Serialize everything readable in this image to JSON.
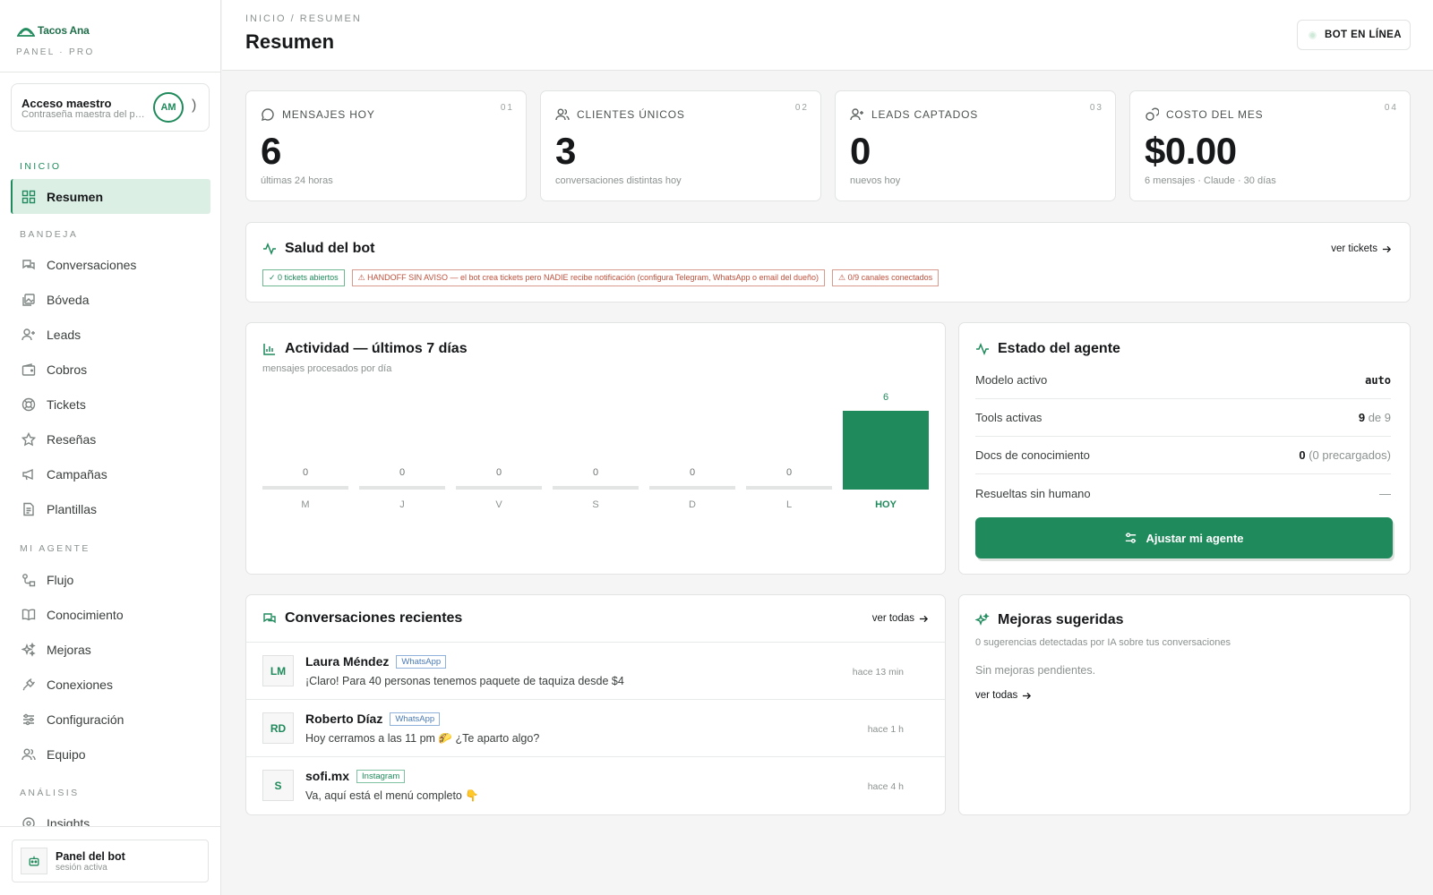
{
  "brand": {
    "name": "Tacos Ana",
    "subtitle": "PANEL · PRO"
  },
  "master_access": {
    "title": "Acceso maestro",
    "subtitle": "Contraseña maestra del panel",
    "initials": "AM",
    "trailing": ")"
  },
  "nav": {
    "sections": [
      "INICIO",
      "BANDEJA",
      "MI AGENTE",
      "ANÁLISIS"
    ],
    "items": [
      {
        "label": "Resumen",
        "icon": "grid-icon"
      },
      {
        "label": "Conversaciones",
        "icon": "chat-icon"
      },
      {
        "label": "Bóveda",
        "icon": "images-icon"
      },
      {
        "label": "Leads",
        "icon": "user-plus-icon"
      },
      {
        "label": "Cobros",
        "icon": "wallet-icon"
      },
      {
        "label": "Tickets",
        "icon": "lifebuoy-icon"
      },
      {
        "label": "Reseñas",
        "icon": "star-icon"
      },
      {
        "label": "Campañas",
        "icon": "megaphone-icon"
      },
      {
        "label": "Plantillas",
        "icon": "file-icon"
      },
      {
        "label": "Flujo",
        "icon": "flow-icon"
      },
      {
        "label": "Conocimiento",
        "icon": "book-icon"
      },
      {
        "label": "Mejoras",
        "icon": "sparkles-icon"
      },
      {
        "label": "Conexiones",
        "icon": "plug-icon"
      },
      {
        "label": "Configuración",
        "icon": "sliders-icon"
      },
      {
        "label": "Equipo",
        "icon": "users-icon"
      },
      {
        "label": "Insights",
        "icon": "radar-icon"
      }
    ]
  },
  "footer": {
    "title": "Panel del bot",
    "subtitle": "sesión activa"
  },
  "header": {
    "breadcrumb": "INICIO / RESUMEN",
    "title": "Resumen",
    "status": "BOT EN LÍNEA"
  },
  "stats": [
    {
      "label": "MENSAJES HOY",
      "num": "01",
      "value": "6",
      "sub": "últimas 24 horas",
      "icon": "message-circle-icon"
    },
    {
      "label": "CLIENTES ÚNICOS",
      "num": "02",
      "value": "3",
      "sub": "conversaciones distintas hoy",
      "icon": "users-icon"
    },
    {
      "label": "LEADS CAPTADOS",
      "num": "03",
      "value": "0",
      "sub": "nuevos hoy",
      "icon": "user-plus-icon"
    },
    {
      "label": "COSTO DEL MES",
      "num": "04",
      "value": "$0.00",
      "sub": "6 mensajes · Claude · 30 días",
      "icon": "coins-icon"
    }
  ],
  "health": {
    "title": "Salud del bot",
    "link": "ver tickets",
    "pills": [
      {
        "text": "✓ 0 tickets abiertos",
        "kind": "ok"
      },
      {
        "text": "⚠ HANDOFF SIN AVISO — el bot crea tickets pero NADIE recibe notificación (configura Telegram, WhatsApp o email del dueño)",
        "kind": "warn"
      },
      {
        "text": "⚠ 0/9 canales conectados",
        "kind": "warn"
      }
    ]
  },
  "activity": {
    "title": "Actividad — últimos 7 días",
    "subtitle": "mensajes procesados por día"
  },
  "chart_data": {
    "type": "bar",
    "categories": [
      "M",
      "J",
      "V",
      "S",
      "D",
      "L",
      "HOY"
    ],
    "values": [
      0,
      0,
      0,
      0,
      0,
      0,
      6
    ],
    "ylim": [
      0,
      6
    ],
    "highlight": "HOY",
    "grid": false,
    "colors": {
      "bar": "#1f8a5b",
      "empty": "#e2e5e3"
    }
  },
  "agent": {
    "title": "Estado del agente",
    "rows": [
      {
        "label": "Modelo activo",
        "value": "auto",
        "suffix": ""
      },
      {
        "label": "Tools activas",
        "value": "9",
        "suffix": " de 9"
      },
      {
        "label": "Docs de conocimiento",
        "value": "0",
        "suffix": " (0 precargados)"
      },
      {
        "label": "Resueltas sin humano",
        "value": "",
        "suffix": "—"
      }
    ],
    "button": "Ajustar mi agente"
  },
  "recent": {
    "title": "Conversaciones recientes",
    "link": "ver todas",
    "items": [
      {
        "initials": "LM",
        "name": "Laura Méndez",
        "channel": "WhatsApp",
        "message": "¡Claro! Para 40 personas tenemos paquete de taquiza desde $4",
        "time": "hace 13 min"
      },
      {
        "initials": "RD",
        "name": "Roberto Díaz",
        "channel": "WhatsApp",
        "message": "Hoy cerramos a las 11 pm 🌮 ¿Te aparto algo?",
        "time": "hace 1 h"
      },
      {
        "initials": "S",
        "name": "sofi.mx",
        "channel": "Instagram",
        "message": "Va, aquí está el menú completo 👇",
        "time": "hace 4 h"
      }
    ]
  },
  "suggestions": {
    "title": "Mejoras sugeridas",
    "subtitle": "0 sugerencias detectadas por IA sobre tus conversaciones",
    "empty": "Sin mejoras pendientes.",
    "link": "ver todas"
  },
  "colors": {
    "accent": "#1f8a5b",
    "warning": "#c0513d",
    "whatsapp_tag": "#4b7bb5"
  }
}
